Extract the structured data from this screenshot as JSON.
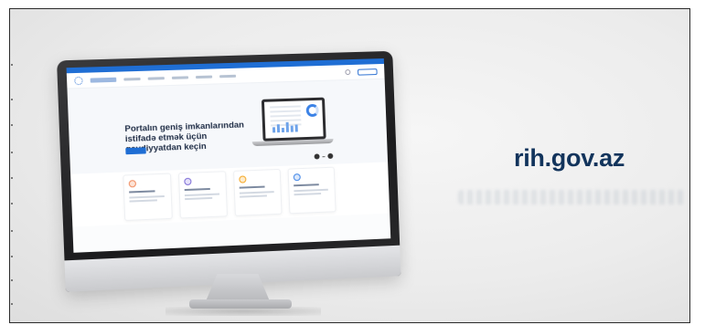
{
  "portal": {
    "hero_title": "Portalın geniş imkanlarından istifadə etmək üçün qeydiyyatdan keçin"
  },
  "brand": {
    "domain": "rih.gov.az"
  },
  "colors": {
    "accent": "#1f6ed4",
    "domain_text": "#12345c",
    "card_icons": [
      "#f08a5d",
      "#7b6ad6",
      "#f5a623",
      "#3b82e6"
    ]
  }
}
